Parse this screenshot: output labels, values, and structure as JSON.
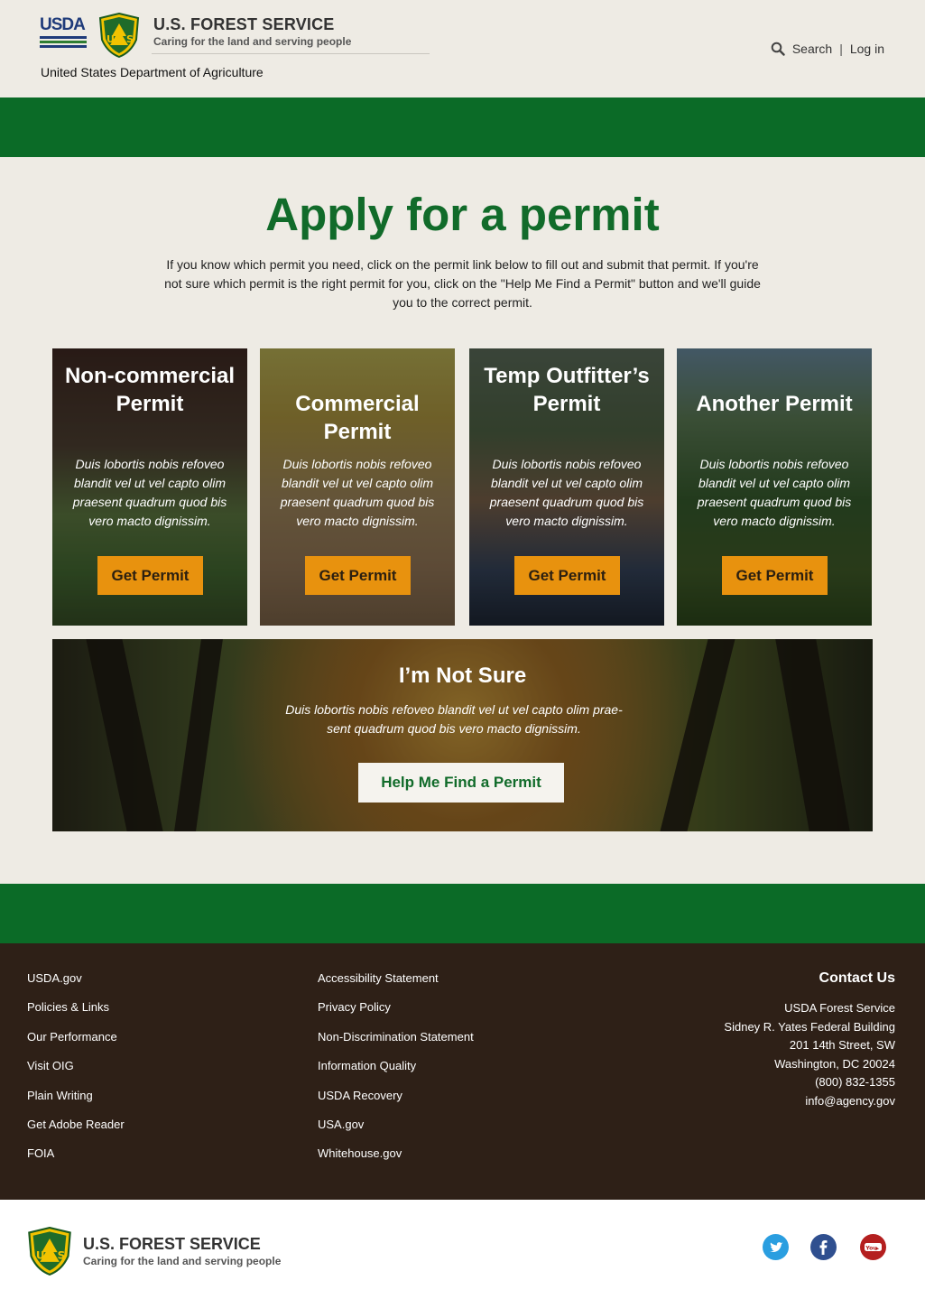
{
  "header": {
    "usda_logo_text": "USDA",
    "agency_title": "U.S. FOREST SERVICE",
    "agency_tagline": "Caring for the land and serving people",
    "department": "United States Department of Agriculture",
    "search_label": "Search",
    "separator": "|",
    "login_label": "Log in",
    "shield_text": "US"
  },
  "colors": {
    "brand_green": "#0b6b27",
    "title_green": "#116b2a",
    "button_orange": "#e8920e",
    "footer_brown": "#2e2017",
    "page_bg": "#eeebe4"
  },
  "main": {
    "title": "Apply for a permit",
    "intro": "If you know which permit you need, click on the permit link below to fill out and submit that permit. If you're not sure which permit is the right permit for you, click on the \"Help Me Find a Permit\" button and we'll guide you to the correct permit.",
    "cards": [
      {
        "title": "Non-commercial Permit",
        "description": "Duis lobortis nobis refoveo blandit vel ut vel capto olim praesent quadrum quod bis vero macto dignissim.",
        "button": "Get Permit"
      },
      {
        "title": "Commercial Permit",
        "description": "Duis lobortis nobis refoveo blandit vel ut vel capto olim praesent quadrum quod bis vero macto dignissim.",
        "button": "Get Permit"
      },
      {
        "title": "Temp Outfitter’s Permit",
        "description": "Duis lobortis nobis refoveo blandit vel ut vel capto olim praesent quadrum quod bis vero macto dignissim.",
        "button": "Get Permit"
      },
      {
        "title": "Another Permit",
        "description": "Duis lobortis nobis refoveo blandit vel ut vel capto olim praesent quadrum quod bis vero macto dignissim.",
        "button": "Get Permit"
      }
    ],
    "not_sure": {
      "title": "I’m Not Sure",
      "description": "Duis lobortis nobis refoveo blandit vel ut vel capto olim prae-sent quadrum quod bis vero macto dignissim.",
      "button": "Help Me Find a Permit"
    }
  },
  "footer": {
    "links_col1": [
      "USDA.gov",
      "Policies & Links",
      "Our Performance",
      "Visit OIG",
      "Plain Writing",
      "Get Adobe Reader",
      "FOIA"
    ],
    "links_col2": [
      "Accessibility Statement",
      "Privacy Policy",
      "Non-Discrimination Statement",
      "Information Quality",
      "USDA Recovery",
      "USA.gov",
      "Whitehouse.gov"
    ],
    "contact": {
      "heading": "Contact Us",
      "lines": [
        "USDA Forest Service",
        "Sidney R. Yates Federal Building",
        "201 14th Street, SW",
        "Washington, DC 20024",
        "(800) 832-1355",
        "info@agency.gov"
      ]
    }
  },
  "bottom": {
    "agency_title": "U.S. FOREST SERVICE",
    "agency_tagline": "Caring for the land and serving people",
    "social_icons": [
      "twitter-icon",
      "facebook-icon",
      "youtube-icon"
    ]
  }
}
